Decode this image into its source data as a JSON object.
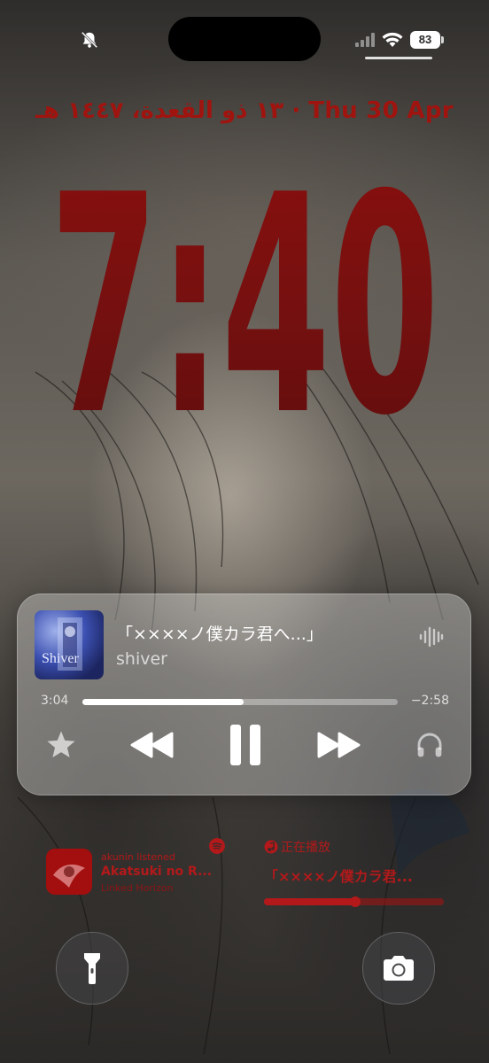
{
  "status": {
    "battery": "83",
    "icons": [
      "silent-bell-icon",
      "cellular-icon",
      "wifi-icon",
      "battery-icon"
    ]
  },
  "lockscreen": {
    "date_line": "١٣ ذو القعدة، ١٤٤٧ هـ · Thu 30 Apr",
    "time": "7:40",
    "accent_color": "#a0140f"
  },
  "player": {
    "artwork_text": "Shiver",
    "title": "「××××ノ僕カラ君へ...」",
    "artist": "shiver",
    "elapsed": "3:04",
    "remaining": "−2:58",
    "progress_fraction": 0.51,
    "icons": [
      "waveform-icon",
      "star-icon",
      "rewind-icon",
      "pause-icon",
      "fast-forward-icon",
      "headphones-icon"
    ]
  },
  "widgets": {
    "left": {
      "subtitle": "akunin listened",
      "title": "Akatsuki no R...",
      "caption": "Linked Horizon",
      "icon": "spotify-icon"
    },
    "right": {
      "label": "正在播放",
      "title": "「××××ノ僕カラ君...",
      "progress_fraction": 0.5,
      "icon": "music-note-icon"
    }
  },
  "buttons": {
    "left_icon": "flashlight-icon",
    "right_icon": "camera-icon"
  }
}
